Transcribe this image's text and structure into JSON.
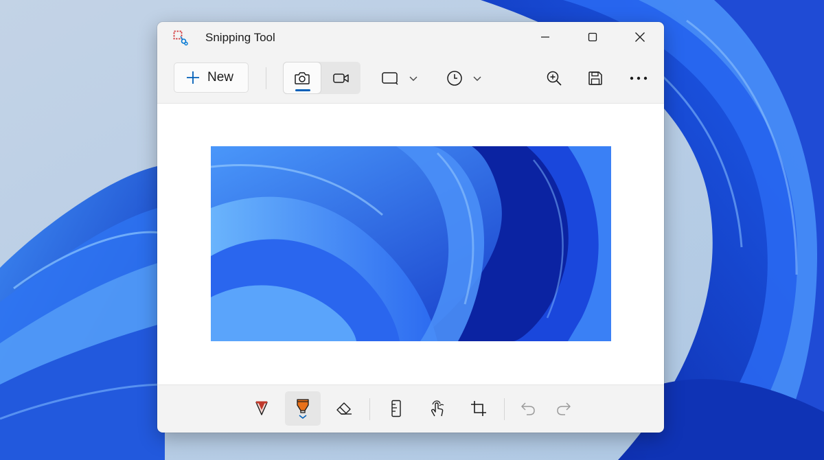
{
  "window": {
    "title": "Snipping Tool"
  },
  "title_controls": {
    "minimize": "minimize-icon",
    "maximize": "maximize-icon",
    "close": "close-icon"
  },
  "toolbar": {
    "new_label": "New",
    "new_icon": "plus-icon",
    "snipping_mode_selected": "screenshot",
    "buttons": [
      {
        "name": "camera-icon",
        "selected": true
      },
      {
        "name": "video-icon",
        "selected": false
      },
      {
        "name": "rectangle-mode-icon"
      },
      {
        "name": "clock-delay-icon"
      },
      {
        "name": "zoom-in-icon"
      },
      {
        "name": "save-icon"
      },
      {
        "name": "more-options-icon"
      }
    ]
  },
  "markup_tools": [
    {
      "name": "ballpoint-pen-icon",
      "color": "#c0392b"
    },
    {
      "name": "highlighter-icon",
      "color": "#e8711b",
      "selected": true
    },
    {
      "name": "eraser-icon"
    },
    {
      "name": "ruler-icon"
    },
    {
      "name": "touch-writing-icon"
    },
    {
      "name": "crop-icon"
    },
    {
      "name": "undo-icon",
      "enabled": false
    },
    {
      "name": "redo-icon",
      "enabled": false
    }
  ],
  "colors": {
    "accent": "#005fb8",
    "wallpaper_blue": "#1a4fe0",
    "window_bg": "#f3f3f3"
  }
}
